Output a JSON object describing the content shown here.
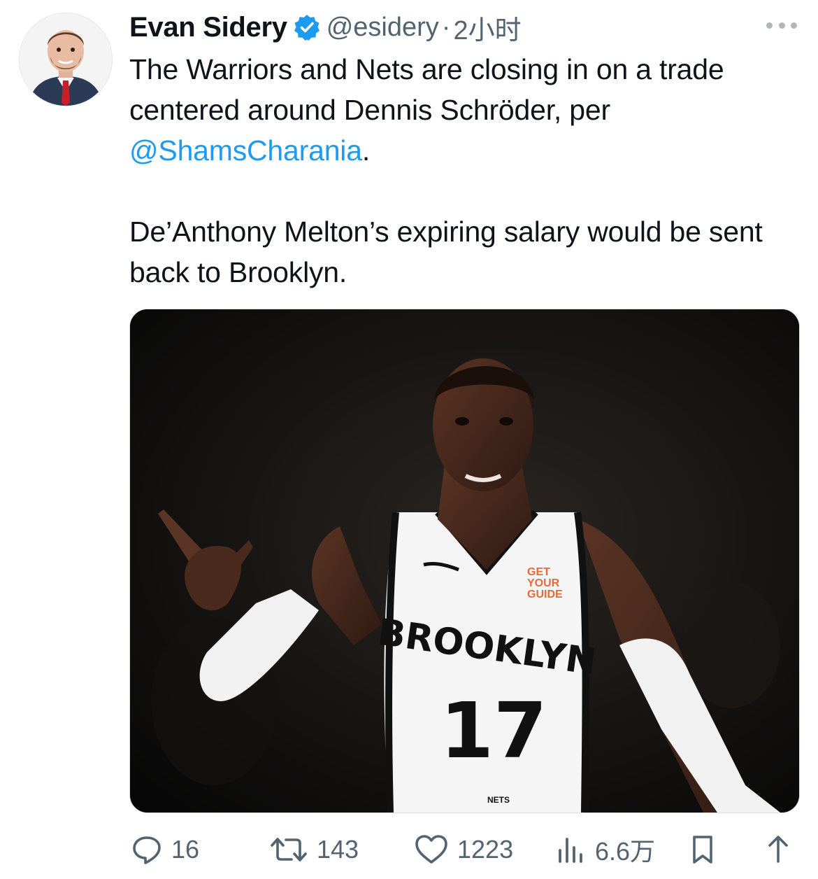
{
  "author": {
    "name": "Evan Sidery",
    "handle": "@esidery",
    "separator": "·",
    "time": "2小时",
    "verified": true
  },
  "tweet": {
    "line1_prefix": "The Warriors and Nets are closing in on a trade centered around Dennis Schröder, per ",
    "mention": "@ShamsCharania",
    "line1_suffix": ".",
    "paragraph2": "De’Anthony Melton’s expiring salary would be sent back to Brooklyn."
  },
  "media": {
    "jersey_team": "BROOKLYN",
    "jersey_number": "17",
    "sponsor": [
      "GET",
      "YOUR",
      "GUIDE"
    ],
    "shorts_logo": "NETS"
  },
  "actions": {
    "replies": "16",
    "retweets": "143",
    "likes": "1223",
    "views": "6.6万"
  },
  "colors": {
    "link": "#1d9bf0",
    "verified": "#1d9bf0",
    "muted": "#536471"
  },
  "icons": [
    "reply-icon",
    "retweet-icon",
    "like-icon",
    "views-icon",
    "bookmark-icon",
    "share-icon",
    "more-icon",
    "verified-icon"
  ]
}
